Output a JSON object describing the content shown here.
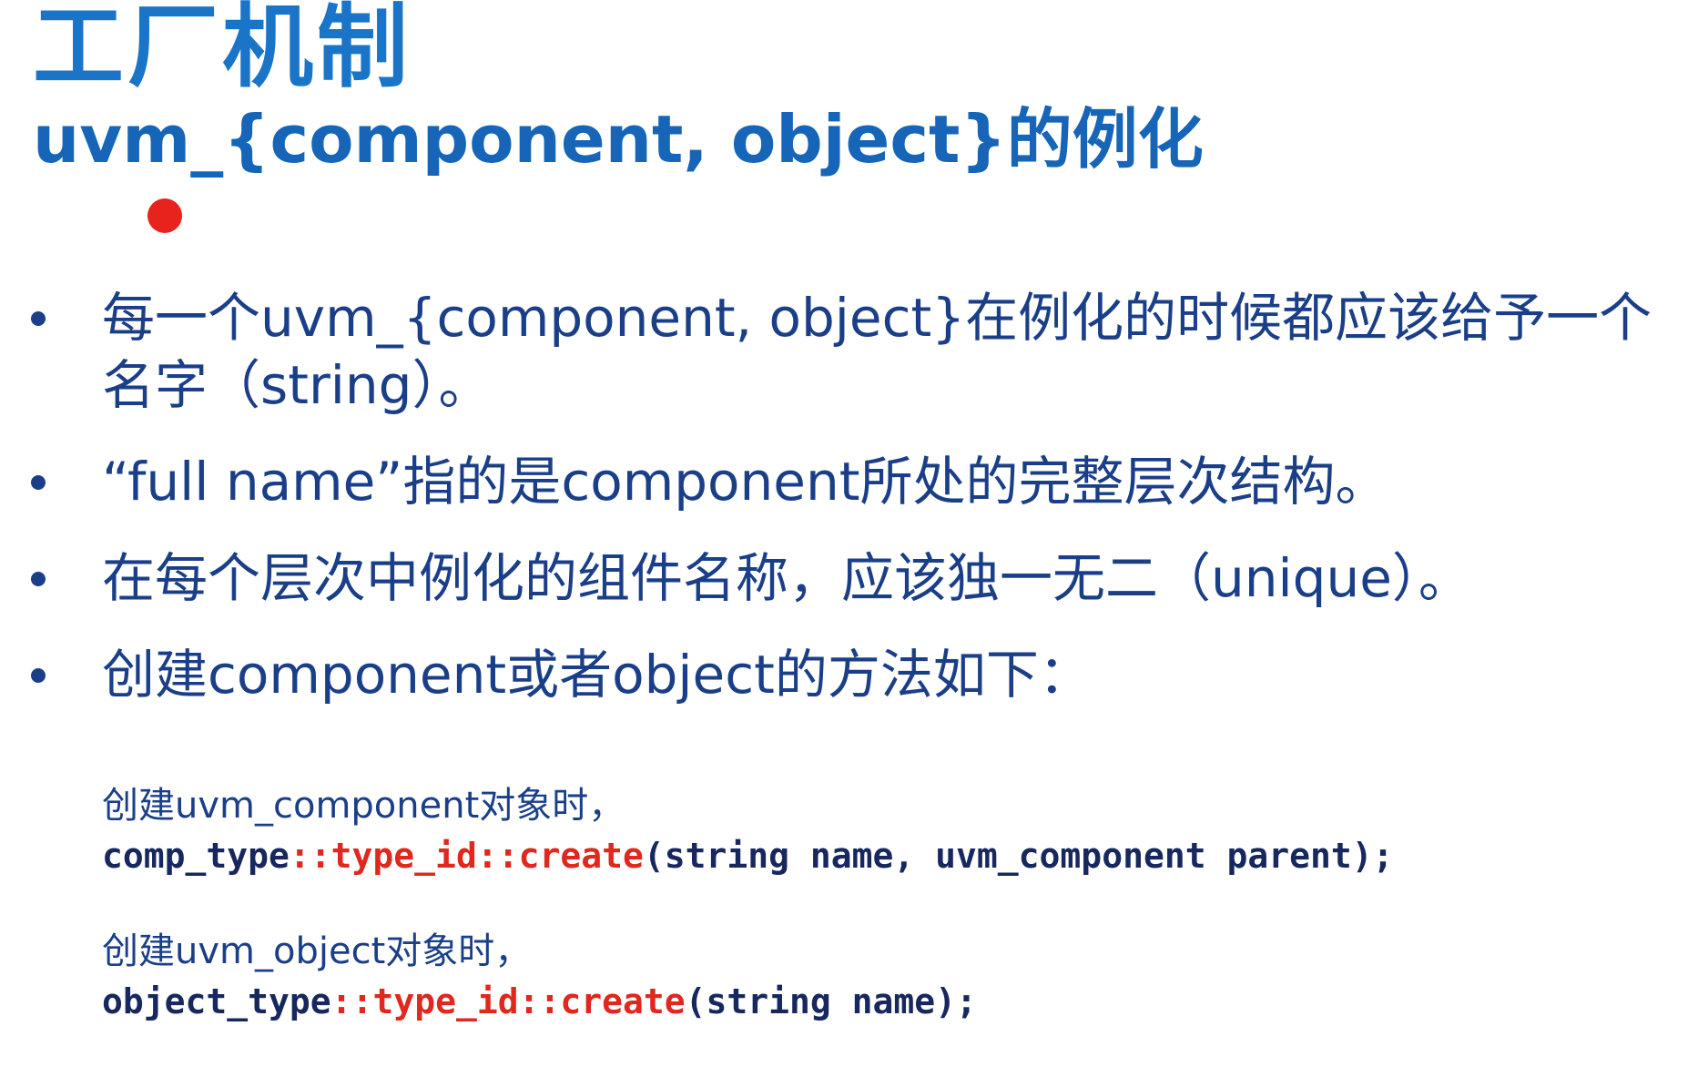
{
  "slide": {
    "title": "工厂机制",
    "subtitle": "uvm_{component, object}的例化",
    "accent_color": "#1a75c9",
    "text_color": "#1a3f88",
    "highlight_color": "#e0281e",
    "bullets": [
      {
        "text": "每一个uvm_{component, object}在例化的时候都应该给予一个名字（string）。"
      },
      {
        "text": "“full name”指的是component所处的完整层次结构。"
      },
      {
        "text": "在每个层次中例化的组件名称，应该独一无二（unique）。"
      },
      {
        "text": "创建component或者object的方法如下："
      }
    ],
    "code_blocks": [
      {
        "label": "创建uvm_component对象时，",
        "code": {
          "type_name": "comp_type",
          "sep1": "::",
          "type_id": "type_id",
          "sep2": "::",
          "create": "create",
          "args": "(string name, uvm_component parent);"
        }
      },
      {
        "label": "创建uvm_object对象时，",
        "code": {
          "type_name": "object_type",
          "sep1": "::",
          "type_id": "type_id",
          "sep2": "::",
          "create": "create",
          "args": "(string name);"
        }
      }
    ]
  }
}
